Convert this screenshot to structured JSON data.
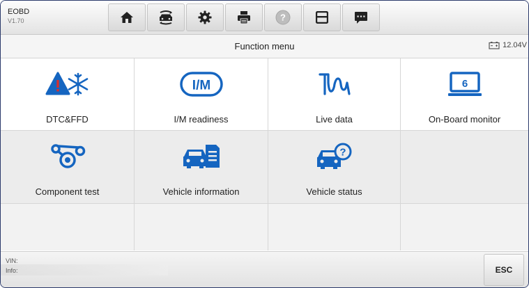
{
  "app": {
    "name": "EOBD",
    "version": "V1.70"
  },
  "toolbar": {
    "icons": [
      "home-icon",
      "vehicle-swap-icon",
      "settings-icon",
      "print-icon",
      "help-icon",
      "save-icon",
      "message-icon"
    ]
  },
  "header": {
    "title": "Function menu",
    "battery_voltage": "12.04V"
  },
  "menu": {
    "items": [
      {
        "label": "DTC&FFD",
        "icon": "dtc-warning-snowflake-icon"
      },
      {
        "label": "I/M readiness",
        "icon": "im-readiness-icon"
      },
      {
        "label": "Live data",
        "icon": "live-data-waveform-icon"
      },
      {
        "label": "On-Board monitor",
        "icon": "onboard-monitor-icon"
      },
      {
        "label": "Component test",
        "icon": "component-test-icon"
      },
      {
        "label": "Vehicle information",
        "icon": "vehicle-information-icon"
      },
      {
        "label": "Vehicle status",
        "icon": "vehicle-status-icon"
      }
    ]
  },
  "footer": {
    "vin_label": "VIN:",
    "info_label": "Info:",
    "esc_label": "ESC"
  },
  "colors": {
    "accent": "#1e73d8",
    "icon_blue": "#1565c0",
    "warning_red": "#d32f2f",
    "frame_border": "#2b3a6b"
  }
}
